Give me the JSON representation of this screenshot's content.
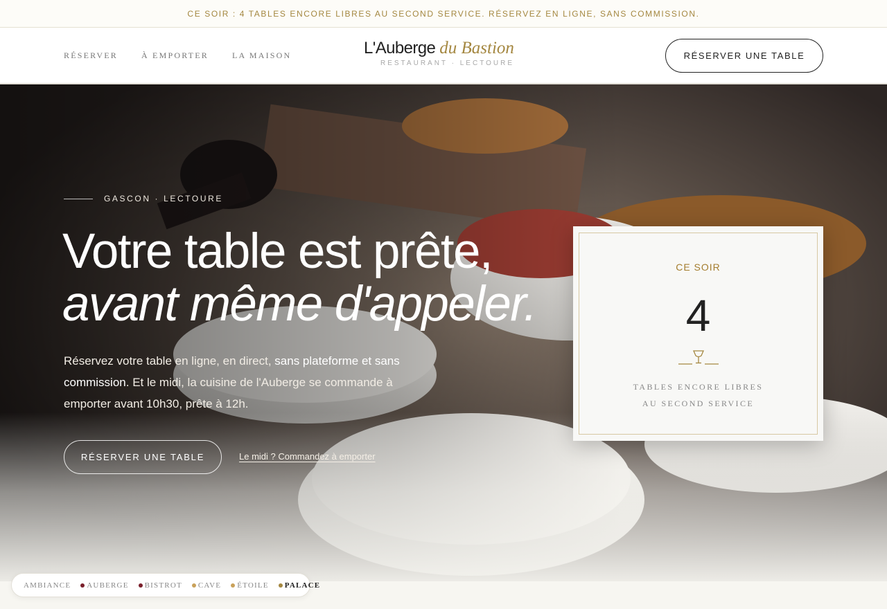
{
  "announcement": "CE SOIR : 4 TABLES ENCORE LIBRES AU SECOND SERVICE. RÉSERVEZ EN LIGNE, SANS COMMISSION.",
  "nav": {
    "items": [
      {
        "label": "RÉSERVER"
      },
      {
        "label": "À EMPORTER"
      },
      {
        "label": "LA MAISON"
      }
    ]
  },
  "logo": {
    "main": "L'Auberge",
    "accent": "du Bastion",
    "sub": "RESTAURANT · LECTOURE"
  },
  "header_cta": "RÉSERVER UNE TABLE",
  "hero": {
    "kicker": "GASCON · LECTOURE",
    "title_line1": "Votre table est prête,",
    "title_line2": "avant même d'appeler.",
    "lead_1": "Réservez votre table en ligne, en direct, ",
    "lead_bold": "sans plateforme et sans commission",
    "lead_2": ". Et le midi, la cuisine de l'Auberge se commande à emporter avant 10h30, prête à 12h.",
    "cta": "RÉSERVER UNE TABLE",
    "link": "Le midi ? Commandez à emporter"
  },
  "tonight_card": {
    "title": "CE SOIR",
    "count": "4",
    "line1": "TABLES ENCORE LIBRES",
    "line2": "AU SECOND SERVICE",
    "icon": "wine-glass-icon"
  },
  "theme_switcher": {
    "items": [
      {
        "label": "AMBIANCE",
        "color": ""
      },
      {
        "label": "AUBERGE",
        "color": "#7a1f2b"
      },
      {
        "label": "BISTROT",
        "color": "#7a1f2b"
      },
      {
        "label": "CAVE",
        "color": "#c9a15a"
      },
      {
        "label": "ÉTOILE",
        "color": "#c9a15a"
      },
      {
        "label": "PALACE",
        "color": "#a48740"
      }
    ],
    "active": "PALACE"
  },
  "colors": {
    "accent": "#a48740",
    "text": "#222222",
    "card_border": "#d7c8a3"
  }
}
